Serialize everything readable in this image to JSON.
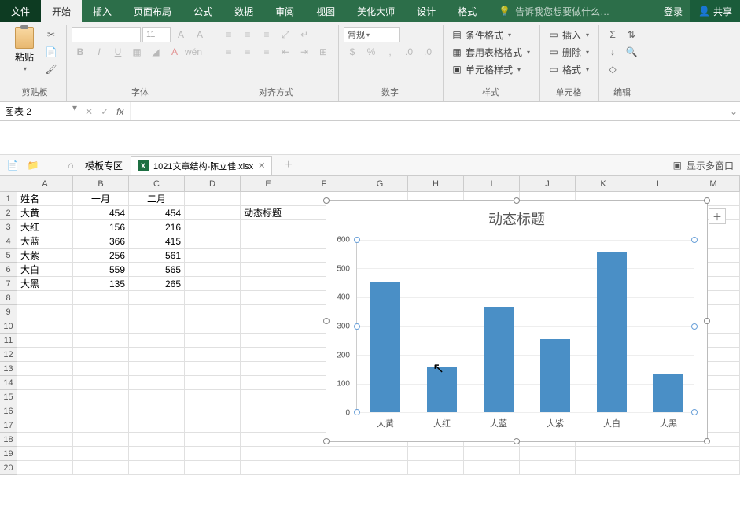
{
  "tabs": {
    "file": "文件",
    "home": "开始",
    "insert": "插入",
    "layout": "页面布局",
    "formula": "公式",
    "data": "数据",
    "review": "审阅",
    "view": "视图",
    "beautify": "美化大师",
    "design": "设计",
    "format": "格式"
  },
  "tellme": "告诉我您想要做什么…",
  "login": "登录",
  "share": "共享",
  "ribbon": {
    "clipboard": "剪贴板",
    "paste": "粘贴",
    "font": "字体",
    "font_placeholder": "",
    "size_placeholder": "11",
    "alignment": "对齐方式",
    "number": "数字",
    "number_format": "常规",
    "styles": "样式",
    "cond_fmt": "条件格式",
    "table_fmt": "套用表格格式",
    "cell_style": "单元格样式",
    "cells": "单元格",
    "insert_btn": "插入",
    "delete_btn": "删除",
    "format_btn": "格式",
    "editing": "编辑"
  },
  "namebox": "图表 2",
  "doctabs": {
    "templates": "模板专区",
    "file": "1021文章结构-陈立佳.xlsx",
    "multiwindow": "显示多窗口"
  },
  "columns": [
    "A",
    "B",
    "C",
    "D",
    "E",
    "F",
    "G",
    "H",
    "I",
    "J",
    "K",
    "L",
    "M"
  ],
  "rownums": [
    "1",
    "2",
    "3",
    "4",
    "5",
    "6",
    "7",
    "8",
    "9",
    "10",
    "11",
    "12",
    "13",
    "14",
    "15",
    "16",
    "17",
    "18",
    "19",
    "20"
  ],
  "table": {
    "headers": {
      "name": "姓名",
      "m1": "一月",
      "m2": "二月"
    },
    "rows": [
      {
        "name": "大黄",
        "m1": "454",
        "m2": "454"
      },
      {
        "name": "大红",
        "m1": "156",
        "m2": "216"
      },
      {
        "name": "大蓝",
        "m1": "366",
        "m2": "415"
      },
      {
        "name": "大紫",
        "m1": "256",
        "m2": "561"
      },
      {
        "name": "大白",
        "m1": "559",
        "m2": "565"
      },
      {
        "name": "大黑",
        "m1": "135",
        "m2": "265"
      }
    ],
    "e2": "动态标题"
  },
  "chart_data": {
    "type": "bar",
    "title": "动态标题",
    "categories": [
      "大黄",
      "大红",
      "大蓝",
      "大紫",
      "大白",
      "大黑"
    ],
    "values": [
      454,
      156,
      366,
      256,
      559,
      135
    ],
    "ylim": [
      0,
      600
    ],
    "yticks": [
      0,
      100,
      200,
      300,
      400,
      500,
      600
    ],
    "xlabel": "",
    "ylabel": ""
  }
}
